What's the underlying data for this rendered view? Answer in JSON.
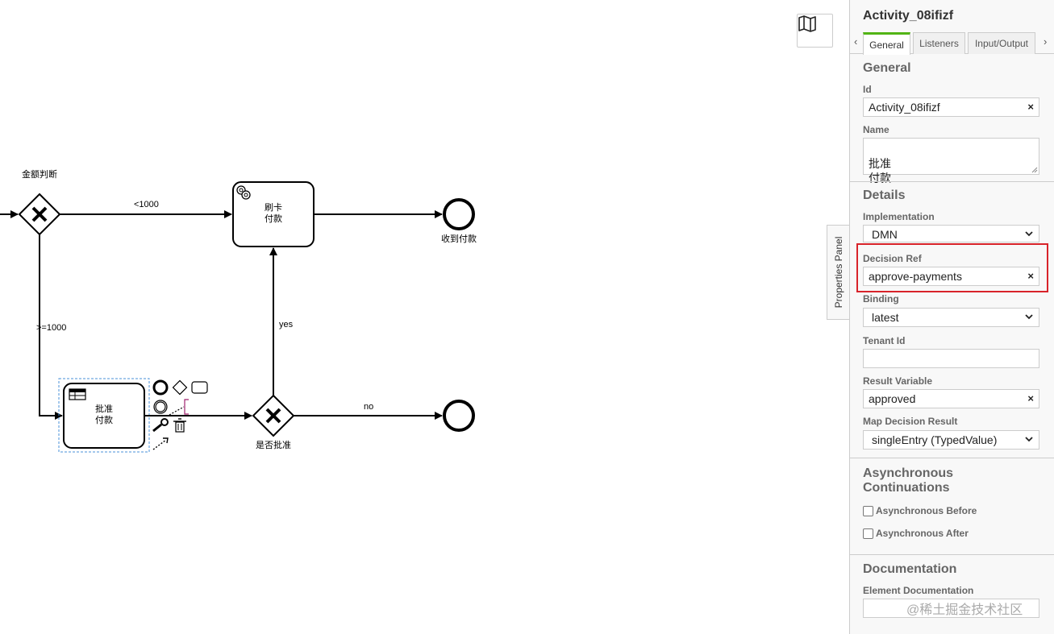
{
  "canvas": {
    "gateway1_label": "金额判断",
    "flow_lt1000": "<1000",
    "flow_ge1000": ">=1000",
    "task_card_label": "刷卡\n付款",
    "end1_label": "收到付款",
    "flow_yes": "yes",
    "task_approve_label": "批准\n付款",
    "gateway2_label": "是否批准",
    "flow_no": "no"
  },
  "toggle": {
    "label": "Properties Panel"
  },
  "panel": {
    "title": "Activity_08ifizf",
    "tabs": [
      "General",
      "Listeners",
      "Input/Output"
    ],
    "tab_prev": "‹",
    "tab_next": "›",
    "general": {
      "title": "General",
      "id_label": "Id",
      "id_value": "Activity_08ifizf",
      "name_label": "Name",
      "name_value": "批准\n付款"
    },
    "details": {
      "title": "Details",
      "impl_label": "Implementation",
      "impl_value": "DMN",
      "decision_ref_label": "Decision Ref",
      "decision_ref_value": "approve-payments",
      "binding_label": "Binding",
      "binding_value": "latest",
      "tenant_label": "Tenant Id",
      "tenant_value": "",
      "result_var_label": "Result Variable",
      "result_var_value": "approved",
      "map_result_label": "Map Decision Result",
      "map_result_value": "singleEntry (TypedValue)"
    },
    "async": {
      "title": "Asynchronous\nContinuations",
      "before_label": "Asynchronous Before",
      "after_label": "Asynchronous After"
    },
    "documentation": {
      "title": "Documentation",
      "element_doc_label": "Element Documentation"
    },
    "clear_symbol": "×"
  },
  "watermark": "@稀土掘金技术社区",
  "colors": {
    "highlight": "#d8232a",
    "tab_active": "#52b415",
    "selection": "#4a90d9"
  }
}
